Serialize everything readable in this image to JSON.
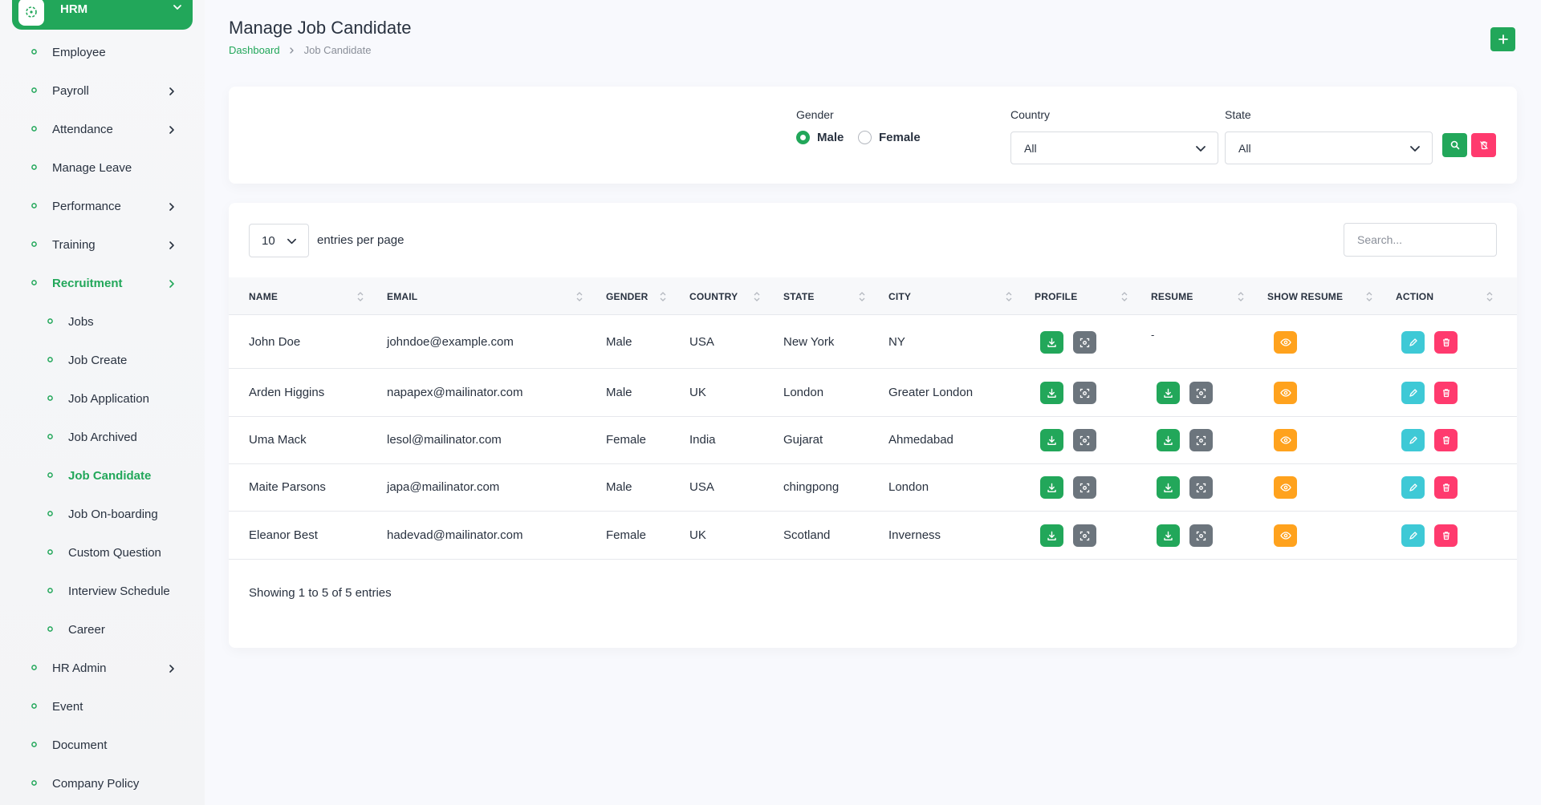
{
  "sidebar": {
    "brand": "HRM",
    "items": [
      {
        "label": "Employee"
      },
      {
        "label": "Payroll"
      },
      {
        "label": "Attendance"
      },
      {
        "label": "Manage Leave"
      },
      {
        "label": "Performance"
      },
      {
        "label": "Training"
      },
      {
        "label": "Recruitment"
      },
      {
        "label": "Jobs"
      },
      {
        "label": "Job Create"
      },
      {
        "label": "Job Application"
      },
      {
        "label": "Job Archived"
      },
      {
        "label": "Job Candidate"
      },
      {
        "label": "Job On-boarding"
      },
      {
        "label": "Custom Question"
      },
      {
        "label": "Interview Schedule"
      },
      {
        "label": "Career"
      },
      {
        "label": "HR Admin"
      },
      {
        "label": "Event"
      },
      {
        "label": "Document"
      },
      {
        "label": "Company Policy"
      }
    ]
  },
  "header": {
    "title": "Manage Job Candidate",
    "breadcrumb_home": "Dashboard",
    "breadcrumb_current": "Job Candidate",
    "add_label": "+"
  },
  "filters": {
    "gender_label": "Gender",
    "male": "Male",
    "female": "Female",
    "selected_gender": "Male",
    "country_label": "Country",
    "country_value": "All",
    "state_label": "State",
    "state_value": "All"
  },
  "table": {
    "entries_value": "10",
    "entries_label": "entries per page",
    "search_placeholder": "Search...",
    "columns": [
      "NAME",
      "EMAIL",
      "GENDER",
      "COUNTRY",
      "STATE",
      "CITY",
      "PROFILE",
      "RESUME",
      "SHOW RESUME",
      "ACTION"
    ],
    "rows": [
      {
        "name": "John Doe",
        "email": "johndoe@example.com",
        "gender": "Male",
        "country": "USA",
        "state": "New York",
        "city": "NY",
        "resume": "-"
      },
      {
        "name": "Arden Higgins",
        "email": "napapex@mailinator.com",
        "gender": "Male",
        "country": "UK",
        "state": "London",
        "city": "Greater London",
        "resume": ""
      },
      {
        "name": "Uma Mack",
        "email": "lesol@mailinator.com",
        "gender": "Female",
        "country": "India",
        "state": "Gujarat",
        "city": "Ahmedabad",
        "resume": ""
      },
      {
        "name": "Maite Parsons",
        "email": "japa@mailinator.com",
        "gender": "Male",
        "country": "USA",
        "state": "chingpong",
        "city": "London",
        "resume": ""
      },
      {
        "name": "Eleanor Best",
        "email": "hadevad@mailinator.com",
        "gender": "Female",
        "country": "UK",
        "state": "Scotland",
        "city": "Inverness",
        "resume": ""
      }
    ],
    "showing": "Showing 1 to 5 of 5 entries"
  },
  "colors": {
    "primary": "#22a75a",
    "danger": "#ff3a6e",
    "warning": "#ffa21d",
    "info": "#3ec9d6",
    "secondary": "#6c757d"
  }
}
